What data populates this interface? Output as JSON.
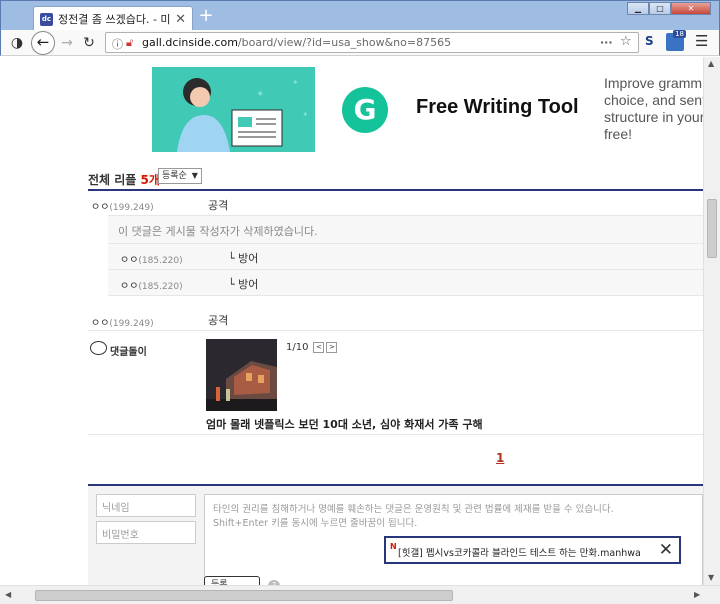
{
  "browser": {
    "tab_title": "정전결 좀 쓰겠습다. - 미국 쇼",
    "tab_favicon": "dc",
    "url_host": "gall.dcinside.com",
    "url_path": "/board/view/?id=usa_show&no=87565",
    "url_prefix": "",
    "ext_label": "S",
    "ext_badge_count": "18"
  },
  "ad": {
    "logo_letter": "G",
    "title": "Free Writing Tool",
    "description": "Improve gramm\nchoice, and sent\nstructure in your\nfree!"
  },
  "comments": {
    "label": "전체 리플",
    "count": "5개",
    "sort_option": "등록순",
    "items": [
      {
        "nick": "ㅇㅇ",
        "ip": "(199.249)",
        "text": "공격"
      },
      {
        "text": "이 댓글은 게시물 작성자가 삭제하였습니다."
      },
      {
        "nick": "ㅇㅇ",
        "ip": "(185.220)",
        "text": "└ 방어"
      },
      {
        "nick": "ㅇㅇ",
        "ip": "(185.220)",
        "text": "└ 방어"
      },
      {
        "nick": "ㅇㅇ",
        "ip": "(199.249)",
        "text": "공격"
      }
    ],
    "dory": {
      "label": "댓글돌이",
      "pager": "1/10",
      "prev": "<",
      "next": ">",
      "title": "엄마 몰래 넷플릭스 보던 10대 소년, 심야 화재서 가족 구해"
    },
    "page_number": "1"
  },
  "write": {
    "nickname_placeholder": "닉네임",
    "password_placeholder": "비밀번호",
    "notice_line1": "타인의 권리를 침해하거나 명예를 훼손하는 댓글은 운영원칙 및 관련 법률에 제재를 받을 수 있습니다.",
    "notice_line2": "Shift+Enter 키를 동시에 누르면 줄바꿈이 됩니다.",
    "submit_label": "등록",
    "help": "?"
  },
  "popup": {
    "tag": "N",
    "text": "[힛갤] 펩시vs코카콜라 블라인드 테스트 하는 만화.manhwa"
  },
  "colors": {
    "accent_navy": "#29367c",
    "count_red": "#d31900",
    "grammarly_green": "#15c39a"
  }
}
